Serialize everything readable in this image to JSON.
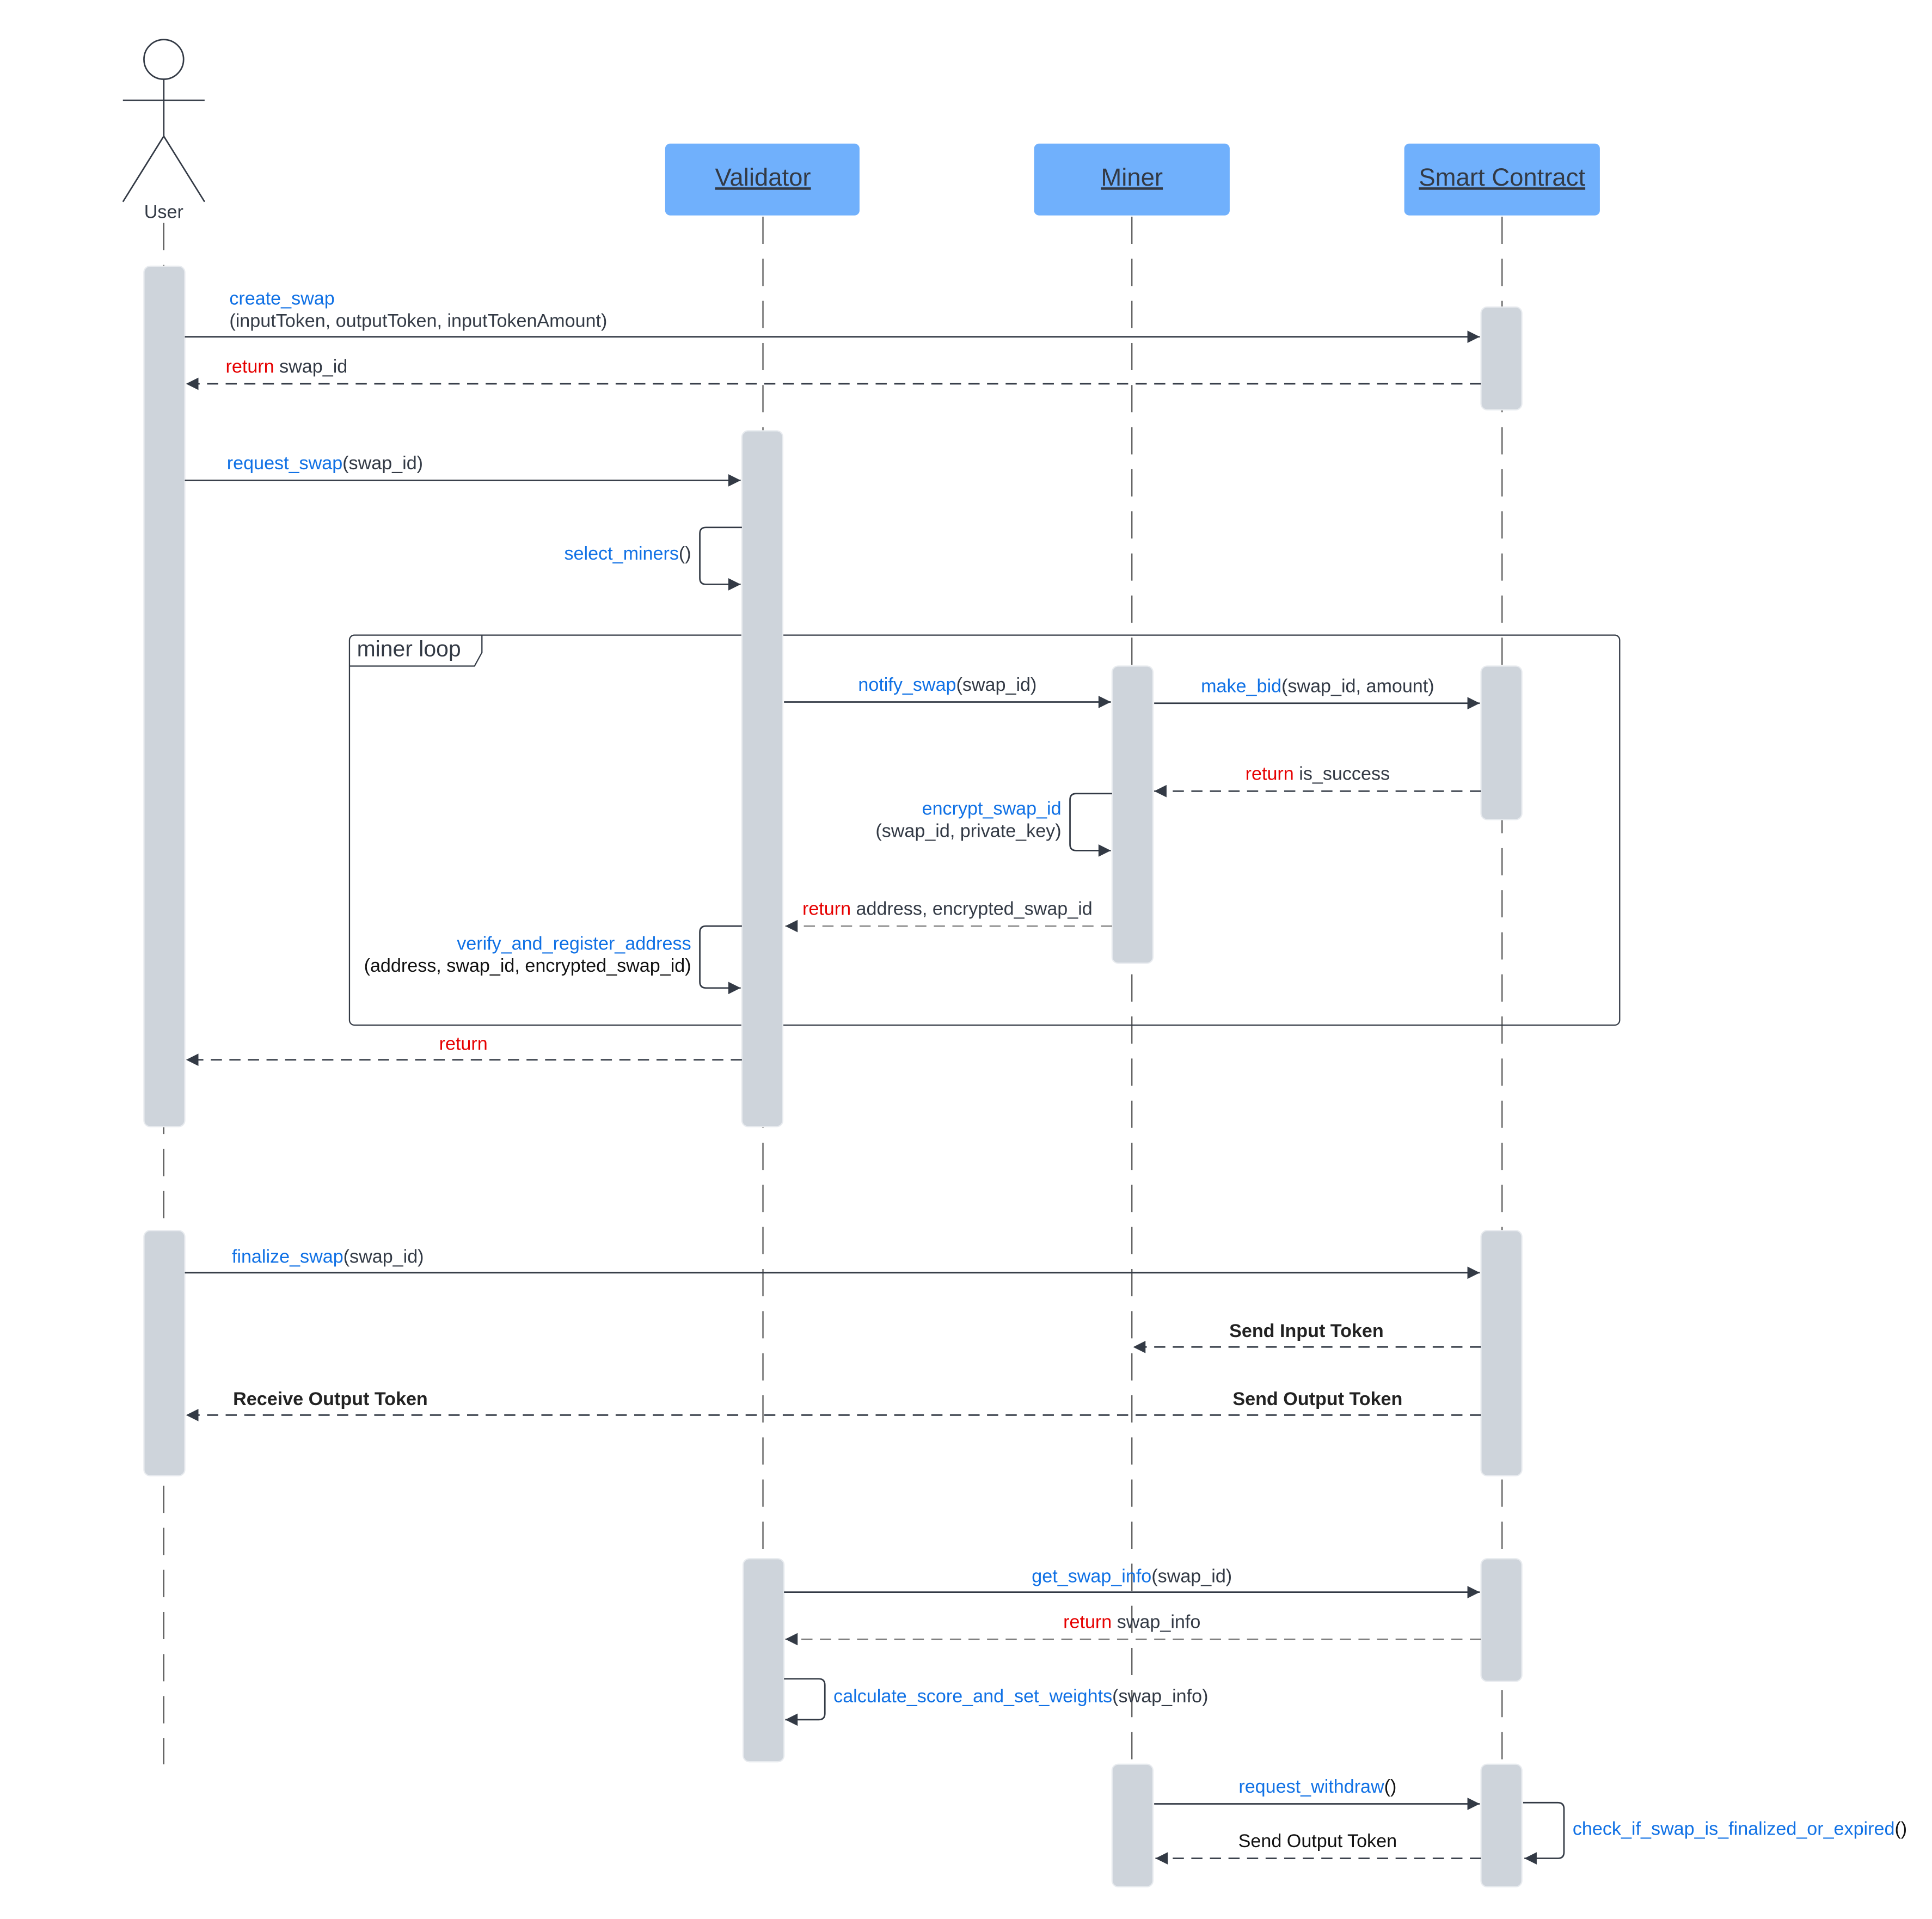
{
  "diagram": {
    "type": "UML sequence diagram",
    "actor": {
      "id": "user",
      "label": "User"
    },
    "participants": [
      {
        "id": "validator",
        "label": "Validator"
      },
      {
        "id": "miner",
        "label": "Miner"
      },
      {
        "id": "contract",
        "label": "Smart Contract"
      }
    ],
    "colors": {
      "participant_fill": "#70b0fc",
      "activation_fill": "#ced4db",
      "function_text": "#1071e5",
      "return_keyword": "#e60000",
      "text": "#333a45"
    },
    "frame": {
      "kind": "loop",
      "label": "miner loop"
    },
    "messages": [
      {
        "from": "user",
        "to": "contract",
        "kind": "call",
        "fn": "create_swap",
        "args_line2": "(inputToken, outputToken, inputTokenAmount)"
      },
      {
        "from": "contract",
        "to": "user",
        "kind": "return",
        "kw": "return",
        "text": " swap_id"
      },
      {
        "from": "user",
        "to": "validator",
        "kind": "call",
        "fn": "request_swap",
        "args": "(swap_id)"
      },
      {
        "from": "validator",
        "to": "validator",
        "kind": "self",
        "fn": "select_miners",
        "args": "()"
      },
      {
        "from": "validator",
        "to": "miner",
        "kind": "call",
        "fn": "notify_swap",
        "args": "(swap_id)",
        "in_frame": true
      },
      {
        "from": "miner",
        "to": "contract",
        "kind": "call",
        "fn": "make_bid",
        "args": "(swap_id, amount)",
        "in_frame": true
      },
      {
        "from": "contract",
        "to": "miner",
        "kind": "return",
        "kw": "return",
        "text": " is_success",
        "in_frame": true
      },
      {
        "from": "miner",
        "to": "miner",
        "kind": "self",
        "fn": "encrypt_swap_id",
        "args_line2": "(swap_id, private_key)",
        "in_frame": true
      },
      {
        "from": "miner",
        "to": "validator",
        "kind": "return",
        "kw": "return",
        "text": " address, encrypted_swap_id",
        "in_frame": true
      },
      {
        "from": "validator",
        "to": "validator",
        "kind": "self",
        "fn": "verify_and_register_address",
        "args_line2": "(address, swap_id, encrypted_swap_id)",
        "in_frame": true
      },
      {
        "from": "validator",
        "to": "user",
        "kind": "return",
        "kw": "return",
        "text": ""
      },
      {
        "from": "user",
        "to": "contract",
        "kind": "call",
        "fn": "finalize_swap",
        "args": "(swap_id)"
      },
      {
        "from": "contract",
        "to": "miner",
        "kind": "return",
        "text_bold": "Send Input Token"
      },
      {
        "from": "contract",
        "to": "user",
        "kind": "return",
        "text_bold": "Send Output Token",
        "target_label_bold": "Receive Output Token"
      },
      {
        "from": "validator",
        "to": "contract",
        "kind": "call",
        "fn": "get_swap_info",
        "args": "(swap_id)"
      },
      {
        "from": "contract",
        "to": "validator",
        "kind": "return",
        "kw": "return",
        "text": " swap_info"
      },
      {
        "from": "validator",
        "to": "validator",
        "kind": "self",
        "fn": "calculate_score_and_set_weights",
        "args": "(swap_info)"
      },
      {
        "from": "miner",
        "to": "contract",
        "kind": "call",
        "fn": "request_withdraw",
        "args": "()"
      },
      {
        "from": "contract",
        "to": "contract",
        "kind": "self",
        "fn": "check_if_swap_is_finalized_or_expired",
        "args": "()"
      },
      {
        "from": "contract",
        "to": "miner",
        "kind": "return",
        "text": "Send Output Token"
      }
    ]
  }
}
